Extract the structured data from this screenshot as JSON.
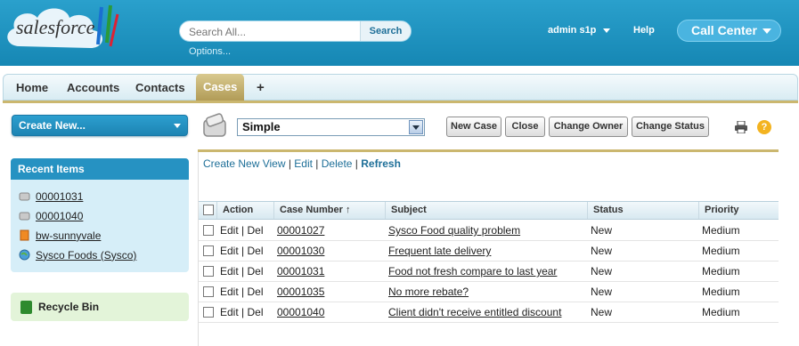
{
  "brand": {
    "logo_text": "salesforce"
  },
  "header": {
    "search": {
      "placeholder": "Search All...",
      "button": "Search"
    },
    "options_link": "Options...",
    "user_menu": "admin s1p",
    "help": "Help",
    "call_center": "Call Center"
  },
  "tabs": [
    {
      "label": "Home"
    },
    {
      "label": "Accounts"
    },
    {
      "label": "Contacts"
    },
    {
      "label": "Cases",
      "active": true
    },
    {
      "label": "+"
    }
  ],
  "sidebar": {
    "create_new": "Create New...",
    "recent_title": "Recent Items",
    "recent_items": [
      {
        "label": "00001031",
        "icon": "case-icon"
      },
      {
        "label": "00001040",
        "icon": "case-icon"
      },
      {
        "label": "bw-sunnyvale",
        "icon": "account-icon"
      },
      {
        "label": "Sysco Foods (Sysco)",
        "icon": "globe-icon"
      }
    ],
    "recycle_bin": "Recycle Bin"
  },
  "list_view": {
    "selected_view": "Simple",
    "buttons": [
      "New Case",
      "Close",
      "Change Owner",
      "Change Status"
    ],
    "links": {
      "create": "Create New View",
      "edit": "Edit",
      "delete": "Delete",
      "refresh": "Refresh"
    },
    "columns": [
      "Action",
      "Case Number ↑",
      "Subject",
      "Status",
      "Priority"
    ],
    "rows": [
      {
        "edit": "Edit",
        "del": "Del",
        "case": "00001027",
        "subject": "Sysco Food quality problem",
        "status": "New",
        "priority": "Medium"
      },
      {
        "edit": "Edit",
        "del": "Del",
        "case": "00001030",
        "subject": "Frequent late delivery",
        "status": "New",
        "priority": "Medium"
      },
      {
        "edit": "Edit",
        "del": "Del",
        "case": "00001031",
        "subject": "Food not fresh compare to last year",
        "status": "New",
        "priority": "Medium"
      },
      {
        "edit": "Edit",
        "del": "Del",
        "case": "00001035",
        "subject": "No more rebate?",
        "status": "New",
        "priority": "Medium"
      },
      {
        "edit": "Edit",
        "del": "Del",
        "case": "00001040",
        "subject": "Client didn't receive entitled discount",
        "status": "New",
        "priority": "Medium"
      }
    ]
  },
  "colors": {
    "brand_blue": "#1d8fba",
    "tab_gold": "#cbb76f",
    "link_blue": "#1e6f98"
  }
}
